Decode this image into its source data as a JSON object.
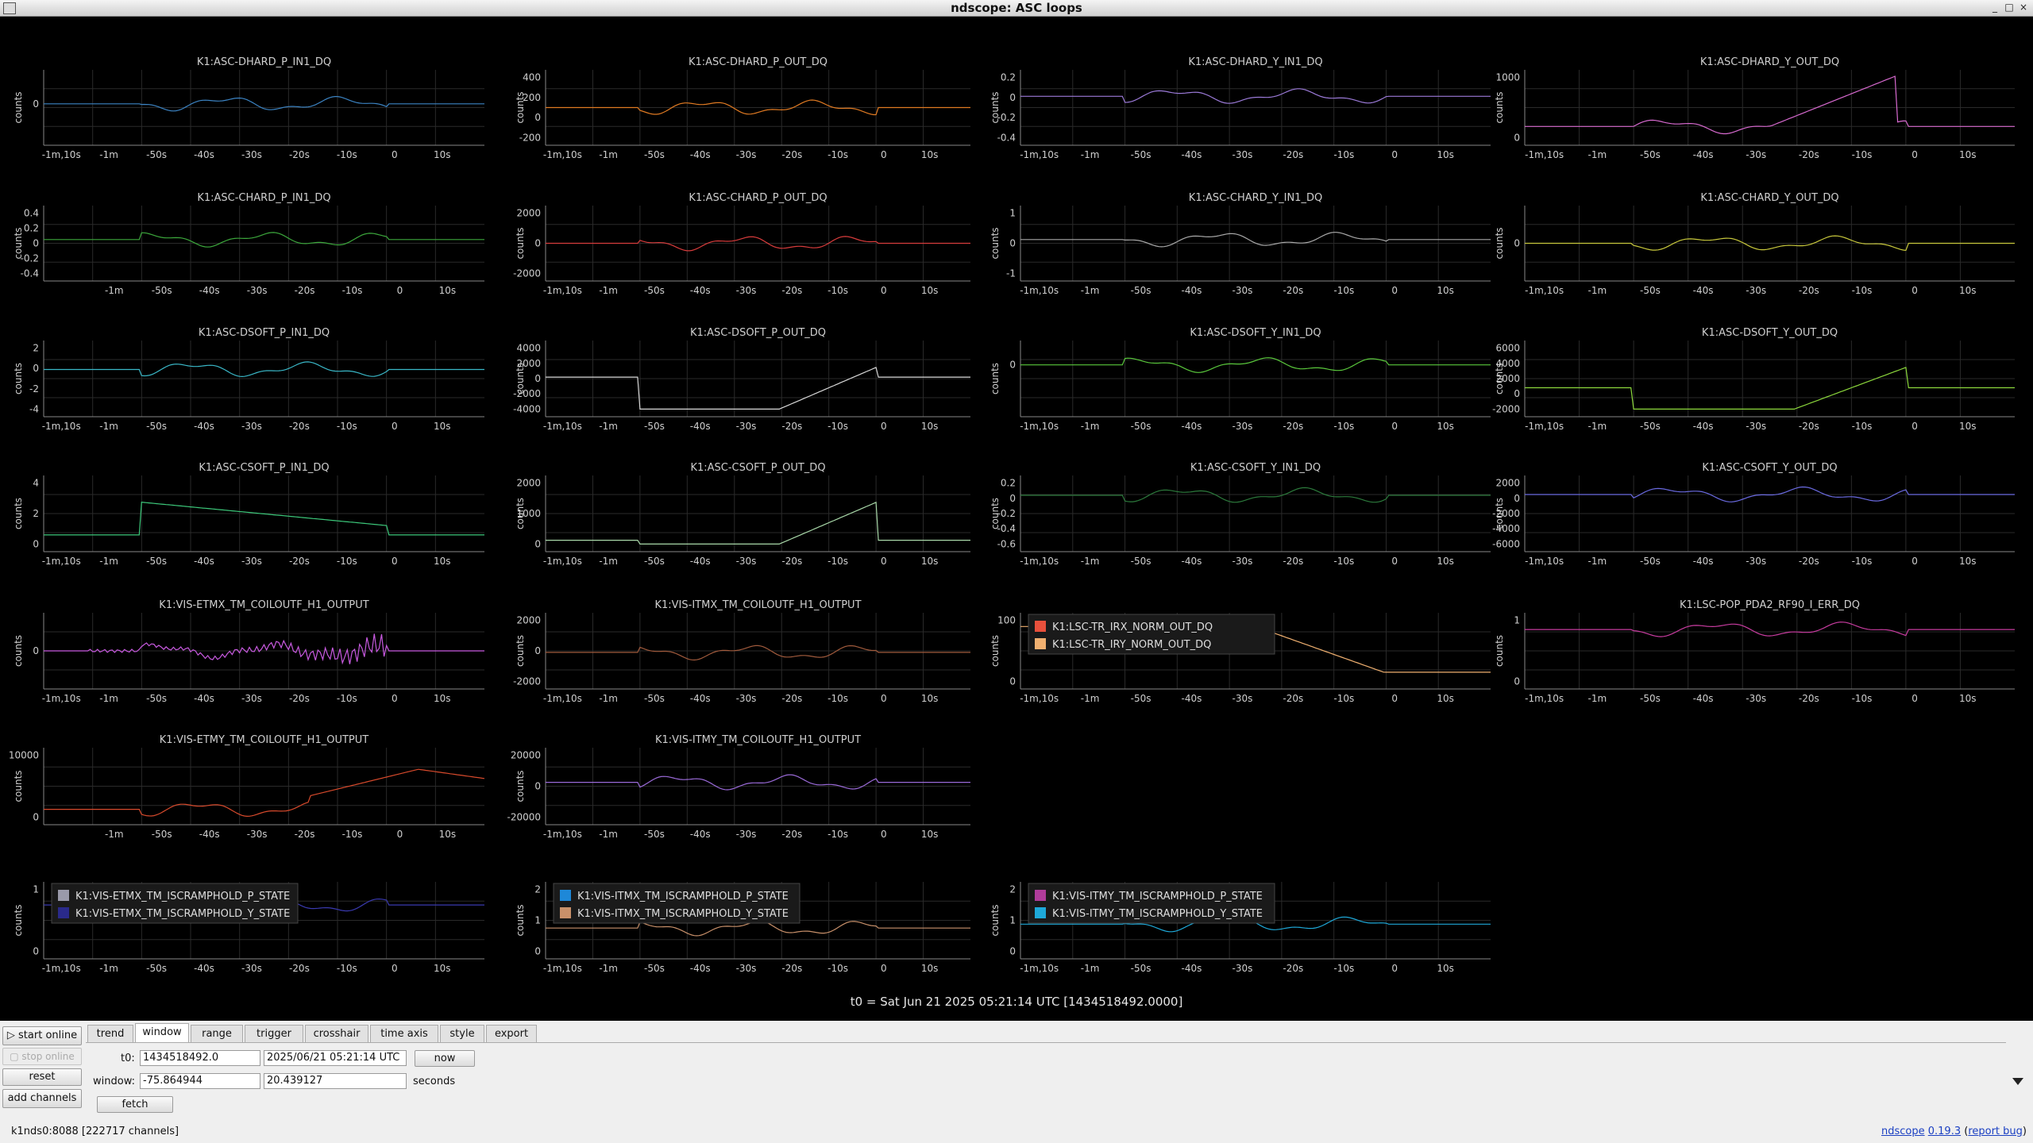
{
  "window": {
    "title": "ndscope: ASC loops"
  },
  "plot_common": {
    "ylabel": "counts",
    "t0_label": "t0 = Sat Jun 21 2025 05:21:14 UTC [1434518492.0000]",
    "colors": {
      "grid": "#2a2a2a",
      "text": "#cfcfcf"
    }
  },
  "chart_data": [
    {
      "title": "K1:ASC-DHARD_P_IN1_DQ",
      "type": "line",
      "color": "#3c84c4",
      "yticks": [
        "0"
      ],
      "xticks": [
        "-1m,10s",
        "-1m",
        "-50s",
        "-40s",
        "-30s",
        "-20s",
        "-10s",
        "0",
        "10s"
      ]
    },
    {
      "title": "K1:ASC-DHARD_P_OUT_DQ",
      "type": "line",
      "color": "#e07a22",
      "yticks": [
        "400",
        "200",
        "0",
        "-200"
      ],
      "xticks": [
        "-1m,10s",
        "-1m",
        "-50s",
        "-40s",
        "-30s",
        "-20s",
        "-10s",
        "0",
        "10s"
      ]
    },
    {
      "title": "K1:ASC-DHARD_Y_IN1_DQ",
      "type": "line",
      "color": "#9b7ad8",
      "yticks": [
        "0.2",
        "0",
        "-0.2",
        "-0.4"
      ],
      "xticks": [
        "-1m,10s",
        "-1m",
        "-50s",
        "-40s",
        "-30s",
        "-20s",
        "-10s",
        "0",
        "10s"
      ]
    },
    {
      "title": "K1:ASC-DHARD_Y_OUT_DQ",
      "type": "line",
      "color": "#d86ad0",
      "yticks": [
        "1000",
        "0"
      ],
      "xticks": [
        "-1m,10s",
        "-1m",
        "-50s",
        "-40s",
        "-30s",
        "-20s",
        "-10s",
        "0",
        "10s"
      ]
    },
    {
      "title": "K1:ASC-CHARD_P_IN1_DQ",
      "type": "line",
      "color": "#3ca83c",
      "yticks": [
        "0.4",
        "0.2",
        "0",
        "-0.2",
        "-0.4"
      ],
      "xticks": [
        "-1m",
        "-50s",
        "-40s",
        "-30s",
        "-20s",
        "-10s",
        "0",
        "10s"
      ]
    },
    {
      "title": "K1:ASC-CHARD_P_OUT_DQ",
      "type": "line",
      "color": "#d83c3c",
      "yticks": [
        "2000",
        "0",
        "-2000"
      ],
      "xticks": [
        "-1m,10s",
        "-1m",
        "-50s",
        "-40s",
        "-30s",
        "-20s",
        "-10s",
        "0",
        "10s"
      ]
    },
    {
      "title": "K1:ASC-CHARD_Y_IN1_DQ",
      "type": "line",
      "color": "#a8a8a8",
      "yticks": [
        "1",
        "0",
        "-1"
      ],
      "xticks": [
        "-1m,10s",
        "-1m",
        "-50s",
        "-40s",
        "-30s",
        "-20s",
        "-10s",
        "0",
        "10s"
      ]
    },
    {
      "title": "K1:ASC-CHARD_Y_OUT_DQ",
      "type": "line",
      "color": "#c8c83c",
      "yticks": [
        "0"
      ],
      "xticks": [
        "-1m,10s",
        "-1m",
        "-50s",
        "-40s",
        "-30s",
        "-20s",
        "-10s",
        "0",
        "10s"
      ]
    },
    {
      "title": "K1:ASC-DSOFT_P_IN1_DQ",
      "type": "line",
      "color": "#3ab8c8",
      "yticks": [
        "2",
        "0",
        "-2",
        "-4"
      ],
      "xticks": [
        "-1m,10s",
        "-1m",
        "-50s",
        "-40s",
        "-30s",
        "-20s",
        "-10s",
        "0",
        "10s"
      ]
    },
    {
      "title": "K1:ASC-DSOFT_P_OUT_DQ",
      "type": "line",
      "color": "#d8d8d8",
      "yticks": [
        "4000",
        "2000",
        "0",
        "-2000",
        "-4000"
      ],
      "xticks": [
        "-1m,10s",
        "-1m",
        "-50s",
        "-40s",
        "-30s",
        "-20s",
        "-10s",
        "0",
        "10s"
      ]
    },
    {
      "title": "K1:ASC-DSOFT_Y_IN1_DQ",
      "type": "line",
      "color": "#5ac83c",
      "yticks": [
        "0"
      ],
      "xticks": [
        "-1m,10s",
        "-1m",
        "-50s",
        "-40s",
        "-30s",
        "-20s",
        "-10s",
        "0",
        "10s"
      ]
    },
    {
      "title": "K1:ASC-DSOFT_Y_OUT_DQ",
      "type": "line",
      "color": "#8cd83c",
      "yticks": [
        "6000",
        "4000",
        "2000",
        "0",
        "-2000"
      ],
      "xticks": [
        "-1m,10s",
        "-1m",
        "-50s",
        "-40s",
        "-30s",
        "-20s",
        "-10s",
        "0",
        "10s"
      ]
    },
    {
      "title": "K1:ASC-CSOFT_P_IN1_DQ",
      "type": "line",
      "color": "#3cc87a",
      "yticks": [
        "4",
        "2",
        "0"
      ],
      "xticks": [
        "-1m,10s",
        "-1m",
        "-50s",
        "-40s",
        "-30s",
        "-20s",
        "-10s",
        "0",
        "10s"
      ]
    },
    {
      "title": "K1:ASC-CSOFT_P_OUT_DQ",
      "type": "line",
      "color": "#a8d8a8",
      "yticks": [
        "2000",
        "1000",
        "0"
      ],
      "xticks": [
        "-1m,10s",
        "-1m",
        "-50s",
        "-40s",
        "-30s",
        "-20s",
        "-10s",
        "0",
        "10s"
      ]
    },
    {
      "title": "K1:ASC-CSOFT_Y_IN1_DQ",
      "type": "line",
      "color": "#2c7a3c",
      "yticks": [
        "0.2",
        "0",
        "-0.2",
        "-0.4",
        "-0.6"
      ],
      "xticks": [
        "-1m,10s",
        "-1m",
        "-50s",
        "-40s",
        "-30s",
        "-20s",
        "-10s",
        "0",
        "10s"
      ]
    },
    {
      "title": "K1:ASC-CSOFT_Y_OUT_DQ",
      "type": "line",
      "color": "#6a6ae0",
      "yticks": [
        "2000",
        "0",
        "-2000",
        "-4000",
        "-6000"
      ],
      "xticks": [
        "-1m,10s",
        "-1m",
        "-50s",
        "-40s",
        "-30s",
        "-20s",
        "-10s",
        "0",
        "10s"
      ]
    },
    {
      "title": "K1:VIS-ETMX_TM_COILOUTF_H1_OUTPUT",
      "type": "line",
      "color": "#c85ae0",
      "yticks": [
        "0"
      ],
      "xticks": [
        "-1m,10s",
        "-1m",
        "-50s",
        "-40s",
        "-30s",
        "-20s",
        "-10s",
        "0",
        "10s"
      ]
    },
    {
      "title": "K1:VIS-ITMX_TM_COILOUTF_H1_OUTPUT",
      "type": "line",
      "color": "#a05a3c",
      "yticks": [
        "2000",
        "0",
        "-2000"
      ],
      "xticks": [
        "-1m,10s",
        "-1m",
        "-50s",
        "-40s",
        "-30s",
        "-20s",
        "-10s",
        "0",
        "10s"
      ]
    },
    {
      "title": "",
      "type": "line",
      "legend": [
        {
          "name": "K1:LSC-TR_IRX_NORM_OUT_DQ",
          "color": "#e8503c"
        },
        {
          "name": "K1:LSC-TR_IRY_NORM_OUT_DQ",
          "color": "#f0b070"
        }
      ],
      "color": "#f0b070",
      "yticks": [
        "100",
        "0"
      ],
      "xticks": [
        "-1m,10s",
        "-1m",
        "-50s",
        "-40s",
        "-30s",
        "-20s",
        "-10s",
        "0",
        "10s"
      ]
    },
    {
      "title": "K1:LSC-POP_PDA2_RF90_I_ERR_DQ",
      "type": "line",
      "color": "#c83ca0",
      "yticks": [
        "1",
        "0"
      ],
      "xticks": [
        "-1m,10s",
        "-1m",
        "-50s",
        "-40s",
        "-30s",
        "-20s",
        "-10s",
        "0",
        "10s"
      ]
    },
    {
      "title": "K1:VIS-ETMY_TM_COILOUTF_H1_OUTPUT",
      "type": "line",
      "color": "#d84a2c",
      "yticks": [
        "10000",
        "0"
      ],
      "xticks": [
        "-1m",
        "-50s",
        "-40s",
        "-30s",
        "-20s",
        "-10s",
        "0",
        "10s"
      ]
    },
    {
      "title": "K1:VIS-ITMY_TM_COILOUTF_H1_OUTPUT",
      "type": "line",
      "color": "#9a6ad8",
      "yticks": [
        "20000",
        "0",
        "-20000"
      ],
      "xticks": [
        "-1m,10s",
        "-1m",
        "-50s",
        "-40s",
        "-30s",
        "-20s",
        "-10s",
        "0",
        "10s"
      ]
    },
    {
      "title": "",
      "type": "line",
      "legend": [
        {
          "name": "K1:VIS-ETMX_TM_ISCRAMPHOLD_P_STATE",
          "color": "#9a9aaa"
        },
        {
          "name": "K1:VIS-ETMX_TM_ISCRAMPHOLD_Y_STATE",
          "color": "#2a2a8a"
        }
      ],
      "color": "#3a3ab0",
      "yticks": [
        "1",
        "0"
      ],
      "xticks": [
        "-1m,10s",
        "-1m",
        "-50s",
        "-40s",
        "-30s",
        "-20s",
        "-10s",
        "0",
        "10s"
      ]
    },
    {
      "title": "",
      "type": "line",
      "legend": [
        {
          "name": "K1:VIS-ITMX_TM_ISCRAMPHOLD_P_STATE",
          "color": "#1e88d8"
        },
        {
          "name": "K1:VIS-ITMX_TM_ISCRAMPHOLD_Y_STATE",
          "color": "#c8906a"
        }
      ],
      "color": "#c8906a",
      "yticks": [
        "2",
        "1",
        "0"
      ],
      "xticks": [
        "-1m,10s",
        "-1m",
        "-50s",
        "-40s",
        "-30s",
        "-20s",
        "-10s",
        "0",
        "10s"
      ]
    },
    {
      "title": "",
      "type": "line",
      "legend": [
        {
          "name": "K1:VIS-ITMY_TM_ISCRAMPHOLD_P_STATE",
          "color": "#b03c9a"
        },
        {
          "name": "K1:VIS-ITMY_TM_ISCRAMPHOLD_Y_STATE",
          "color": "#1ea8d8"
        }
      ],
      "color": "#1ea8d8",
      "yticks": [
        "2",
        "1",
        "0"
      ],
      "xticks": [
        "-1m,10s",
        "-1m",
        "-50s",
        "-40s",
        "-30s",
        "-20s",
        "-10s",
        "0",
        "10s"
      ]
    }
  ],
  "controls": {
    "start_online": "start online",
    "stop_online": "stop online",
    "reset": "reset",
    "add_channels": "add channels",
    "tabs": [
      "trend",
      "window",
      "range",
      "trigger",
      "crosshair",
      "time axis",
      "style",
      "export"
    ],
    "t0_label": "t0:",
    "t0_value": "1434518492.0",
    "t0_utc": "2025/06/21 05:21:14 UTC",
    "now": "now",
    "window_label": "window:",
    "window_start": "-75.864944",
    "window_end": "20.439127",
    "seconds": "seconds",
    "fetch": "fetch"
  },
  "status": {
    "server": "k1nds0:8088 [222717 channels]",
    "app_name": "ndscope",
    "version": "0.19.3",
    "report_bug": "report bug"
  }
}
